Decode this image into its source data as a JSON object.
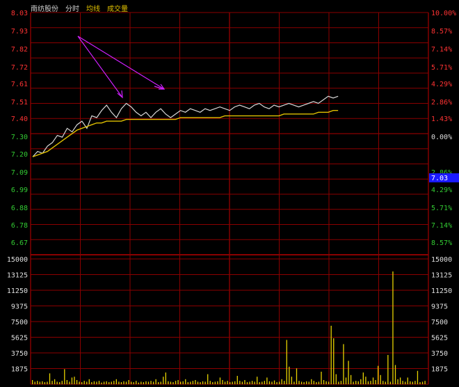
{
  "header": {
    "stock_name": "南纺股份",
    "tab_time": "分时",
    "legend_avg": "均线",
    "legend_volume": "成交量"
  },
  "price_axis": {
    "left_labels": [
      "8.03",
      "7.93",
      "7.82",
      "7.72",
      "7.61",
      "7.51",
      "7.40",
      "7.30",
      "7.20",
      "7.09",
      "6.99",
      "6.88",
      "6.78",
      "6.67"
    ],
    "right_labels": [
      "10.00%",
      "8.57%",
      "7.14%",
      "5.71%",
      "4.29%",
      "2.86%",
      "1.43%",
      "0.00%",
      "2.86%",
      "4.29%",
      "5.71%",
      "7.14%",
      "8.57%"
    ],
    "current_price_tag": "7.03"
  },
  "volume_axis": {
    "labels": [
      "15000",
      "13125",
      "11250",
      "9375",
      "7500",
      "5625",
      "3750",
      "1875"
    ]
  },
  "colors": {
    "background": "#000000",
    "grid": "#8b0000",
    "up": "#ff3333",
    "down": "#33cc33",
    "price_line": "#d8d8d8",
    "avg_line": "#e0c000",
    "volume_bar": "#e6d200",
    "annotation": "#d020ff",
    "header_name": "#cfcfcf",
    "header_avg": "#e0c000",
    "header_vol": "#e0c000",
    "tag_bg": "#1a1aff"
  },
  "chart_data": {
    "type": "line",
    "series": [
      {
        "values": [
          7.22,
          7.25,
          7.24,
          7.28,
          7.3,
          7.34,
          7.33,
          7.38,
          7.36,
          7.4,
          7.42,
          7.38,
          7.45,
          7.44,
          7.48,
          7.51,
          7.47,
          7.44,
          7.49,
          7.52,
          7.5,
          7.47,
          7.45,
          7.47,
          7.44,
          7.47,
          7.49,
          7.46,
          7.44,
          7.46,
          7.48,
          7.47,
          7.49,
          7.48,
          7.47,
          7.49,
          7.48,
          7.49,
          7.5,
          7.49,
          7.48,
          7.5,
          7.51,
          7.5,
          7.49,
          7.51,
          7.52,
          7.5,
          7.49,
          7.51,
          7.5,
          7.51,
          7.52,
          7.51,
          7.5,
          7.51,
          7.52,
          7.53,
          7.52,
          7.54,
          7.56,
          7.55,
          7.56
        ]
      },
      {
        "values": [
          7.22,
          7.23,
          7.24,
          7.25,
          7.27,
          7.29,
          7.31,
          7.33,
          7.35,
          7.37,
          7.38,
          7.39,
          7.4,
          7.41,
          7.41,
          7.42,
          7.42,
          7.42,
          7.42,
          7.43,
          7.43,
          7.43,
          7.43,
          7.43,
          7.43,
          7.43,
          7.43,
          7.43,
          7.43,
          7.43,
          7.44,
          7.44,
          7.44,
          7.44,
          7.44,
          7.44,
          7.44,
          7.44,
          7.44,
          7.45,
          7.45,
          7.45,
          7.45,
          7.45,
          7.45,
          7.45,
          7.45,
          7.45,
          7.45,
          7.45,
          7.45,
          7.46,
          7.46,
          7.46,
          7.46,
          7.46,
          7.46,
          7.46,
          7.47,
          7.47,
          7.47,
          7.48,
          7.48
        ]
      }
    ],
    "volumes": [
      500,
      300,
      400,
      300,
      350,
      250,
      300,
      1300,
      400,
      600,
      300,
      250,
      400,
      1800,
      500,
      300,
      800,
      900,
      500,
      300,
      250,
      400,
      300,
      600,
      250,
      350,
      300,
      400,
      200,
      300,
      350,
      250,
      300,
      400,
      600,
      300,
      250,
      350,
      300,
      500,
      300,
      250,
      400,
      200,
      300,
      250,
      350,
      300,
      400,
      300,
      600,
      250,
      300,
      900,
      1400,
      350,
      300,
      250,
      400,
      500,
      300,
      350,
      600,
      250,
      300,
      400,
      500,
      300,
      250,
      350,
      300,
      1200,
      400,
      250,
      300,
      350,
      800,
      500,
      300,
      400,
      250,
      300,
      350,
      1000,
      400,
      300,
      500,
      250,
      300,
      400,
      300,
      900,
      250,
      300,
      400,
      800,
      350,
      300,
      450,
      250,
      300,
      600,
      400,
      5300,
      2100,
      900,
      300,
      1900,
      400,
      300,
      250,
      350,
      300,
      600,
      400,
      250,
      300,
      1500,
      500,
      350,
      300,
      7000,
      5500,
      1200,
      300,
      400,
      4800,
      800,
      2800,
      1100,
      300,
      400,
      350,
      600,
      1400,
      900,
      350,
      400,
      800,
      500,
      2200,
      1100,
      400,
      300,
      3500,
      300,
      13500,
      2300,
      600,
      800,
      400,
      300,
      800,
      350,
      300,
      400,
      1600,
      250,
      300,
      400
    ],
    "ylim": [
      6.67,
      8.03
    ],
    "volume_ylim": [
      0,
      15000
    ]
  }
}
